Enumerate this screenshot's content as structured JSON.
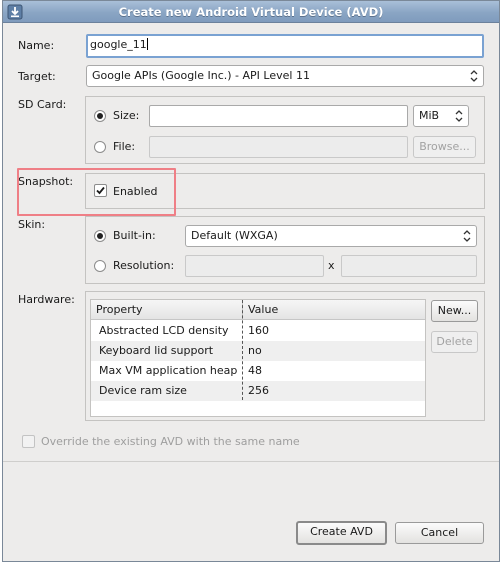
{
  "window": {
    "title": "Create new Android Virtual Device (AVD)",
    "icon": "android-download-icon"
  },
  "name": {
    "label": "Name:",
    "value": "google_11"
  },
  "target": {
    "label": "Target:",
    "selected": "Google APIs (Google Inc.) - API Level 11"
  },
  "sdcard": {
    "label": "SD Card:",
    "size_label": "Size:",
    "size_value": "",
    "unit_selected": "MiB",
    "file_label": "File:",
    "file_value": "",
    "browse_label": "Browse...",
    "selected_option": "size"
  },
  "snapshot": {
    "label": "Snapshot:",
    "enabled_label": "Enabled",
    "enabled_checked": true
  },
  "skin": {
    "label": "Skin:",
    "builtin_label": "Built-in:",
    "builtin_selected": "Default (WXGA)",
    "resolution_label": "Resolution:",
    "x_label": "x",
    "width_value": "",
    "height_value": "",
    "selected_option": "builtin"
  },
  "hardware": {
    "label": "Hardware:",
    "columns": [
      "Property",
      "Value"
    ],
    "rows": [
      {
        "property": "Abstracted LCD density",
        "value": "160"
      },
      {
        "property": "Keyboard lid support",
        "value": "no"
      },
      {
        "property": "Max VM application heap",
        "value": "48"
      },
      {
        "property": "Device ram size",
        "value": "256"
      }
    ],
    "new_label": "New...",
    "delete_label": "Delete"
  },
  "override": {
    "label": "Override the existing AVD with the same name",
    "checked": false
  },
  "footer": {
    "create_label": "Create AVD",
    "cancel_label": "Cancel"
  }
}
